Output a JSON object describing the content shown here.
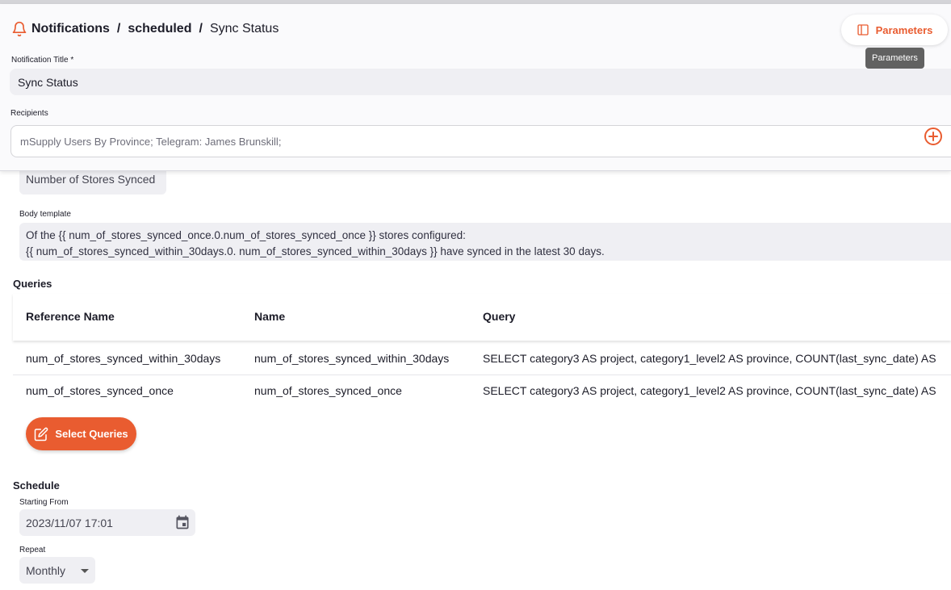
{
  "breadcrumb": {
    "root": "Notifications",
    "middle": "scheduled",
    "current": "Sync Status",
    "separator": "/"
  },
  "parameters_button": {
    "label": "Parameters",
    "tooltip": "Parameters"
  },
  "title_field": {
    "label": "Notification Title *",
    "value": "Sync Status"
  },
  "recipients": {
    "label": "Recipients",
    "value": "mSupply Users By Province; Telegram: James Brunskill;"
  },
  "subject_field": {
    "value": "Number of Stores Synced"
  },
  "body_template": {
    "label": "Body template",
    "line1": "Of the  {{ num_of_stores_synced_once.0.num_of_stores_synced_once }} stores configured:",
    "line2": "{{ num_of_stores_synced_within_30days.0. num_of_stores_synced_within_30days }} have synced in the latest 30 days."
  },
  "queries": {
    "title": "Queries",
    "columns": [
      "Reference Name",
      "Name",
      "Query"
    ],
    "rows": [
      [
        "num_of_stores_synced_within_30days",
        "num_of_stores_synced_within_30days",
        "SELECT category3 AS project, category1_level2 AS province, COUNT(last_sync_date) AS"
      ],
      [
        "num_of_stores_synced_once",
        "num_of_stores_synced_once",
        "SELECT category3 AS project, category1_level2 AS province, COUNT(last_sync_date) AS"
      ]
    ],
    "select_button": "Select Queries"
  },
  "schedule": {
    "title": "Schedule",
    "starting_from_label": "Starting From",
    "starting_from_value": "2023/11/07 17:01",
    "repeat_label": "Repeat",
    "repeat_value": "Monthly"
  },
  "colors": {
    "accent": "#e95c30",
    "field_bg": "#efeff3",
    "tooltip_bg": "#616161"
  },
  "icons": {
    "bell": "bell-icon",
    "parameters": "sidebar-panel-icon",
    "add": "add-circle-icon",
    "edit": "edit-icon",
    "calendar": "calendar-icon",
    "dropdown": "chevron-down-icon"
  }
}
